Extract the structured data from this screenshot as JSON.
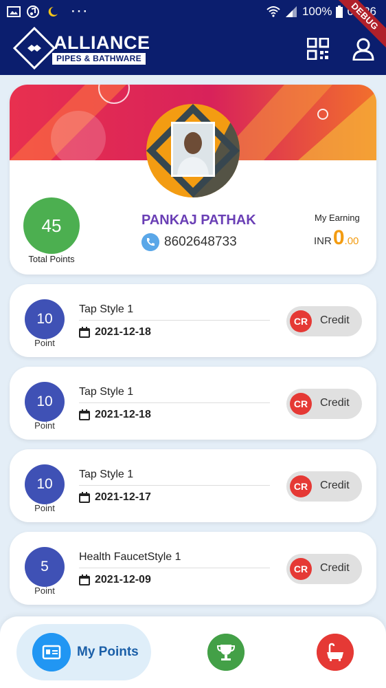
{
  "status_bar": {
    "battery": "100%",
    "time": "08:26",
    "icons": [
      "image-icon",
      "music-icon",
      "moon-icon",
      "more-dots-icon",
      "wifi-icon",
      "signal-icon",
      "battery-icon"
    ]
  },
  "app_bar": {
    "brand_name": "ALLIANCE",
    "brand_sub": "PIPES & BATHWARE",
    "debug_ribbon": "DEBUG",
    "icons": [
      "qr-code-icon",
      "profile-icon"
    ]
  },
  "profile": {
    "total_points": "45",
    "total_points_label": "Total Points",
    "name": "PANKAJ PATHAK",
    "phone": "8602648733",
    "earning_label": "My Earning",
    "earning_currency": "INR",
    "earning_integer": "0",
    "earning_decimal": ".00"
  },
  "transactions": [
    {
      "points": "10",
      "points_label": "Point",
      "title": "Tap Style 1",
      "date": "2021-12-18",
      "badge": "CR",
      "type": "Credit"
    },
    {
      "points": "10",
      "points_label": "Point",
      "title": "Tap Style 1",
      "date": "2021-12-18",
      "badge": "CR",
      "type": "Credit"
    },
    {
      "points": "10",
      "points_label": "Point",
      "title": "Tap Style 1",
      "date": "2021-12-17",
      "badge": "CR",
      "type": "Credit"
    },
    {
      "points": "5",
      "points_label": "Point",
      "title": "Health FaucetStyle 1",
      "date": "2021-12-09",
      "badge": "CR",
      "type": "Credit"
    }
  ],
  "bottom_nav": {
    "active_label": "My Points",
    "items": [
      "points-card-icon",
      "trophy-icon",
      "bathtub-icon"
    ]
  },
  "colors": {
    "primary": "#0b1e6e",
    "points_green": "#4caf50",
    "txn_blue": "#3f51b5",
    "credit_red": "#e53935",
    "name_purple": "#6a3fb5",
    "earning_orange": "#f39c12"
  }
}
